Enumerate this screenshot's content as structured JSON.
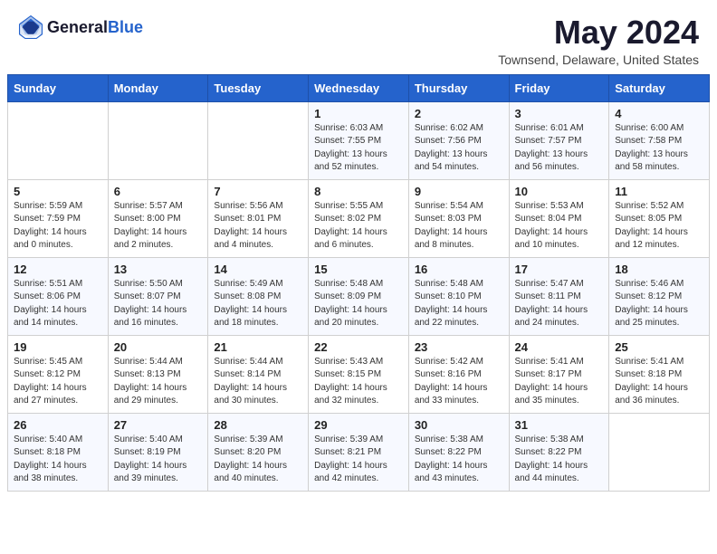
{
  "header": {
    "logo_general": "General",
    "logo_blue": "Blue",
    "month_year": "May 2024",
    "location": "Townsend, Delaware, United States"
  },
  "days_of_week": [
    "Sunday",
    "Monday",
    "Tuesday",
    "Wednesday",
    "Thursday",
    "Friday",
    "Saturday"
  ],
  "weeks": [
    [
      {
        "day": "",
        "info": ""
      },
      {
        "day": "",
        "info": ""
      },
      {
        "day": "",
        "info": ""
      },
      {
        "day": "1",
        "info": "Sunrise: 6:03 AM\nSunset: 7:55 PM\nDaylight: 13 hours\nand 52 minutes."
      },
      {
        "day": "2",
        "info": "Sunrise: 6:02 AM\nSunset: 7:56 PM\nDaylight: 13 hours\nand 54 minutes."
      },
      {
        "day": "3",
        "info": "Sunrise: 6:01 AM\nSunset: 7:57 PM\nDaylight: 13 hours\nand 56 minutes."
      },
      {
        "day": "4",
        "info": "Sunrise: 6:00 AM\nSunset: 7:58 PM\nDaylight: 13 hours\nand 58 minutes."
      }
    ],
    [
      {
        "day": "5",
        "info": "Sunrise: 5:59 AM\nSunset: 7:59 PM\nDaylight: 14 hours\nand 0 minutes."
      },
      {
        "day": "6",
        "info": "Sunrise: 5:57 AM\nSunset: 8:00 PM\nDaylight: 14 hours\nand 2 minutes."
      },
      {
        "day": "7",
        "info": "Sunrise: 5:56 AM\nSunset: 8:01 PM\nDaylight: 14 hours\nand 4 minutes."
      },
      {
        "day": "8",
        "info": "Sunrise: 5:55 AM\nSunset: 8:02 PM\nDaylight: 14 hours\nand 6 minutes."
      },
      {
        "day": "9",
        "info": "Sunrise: 5:54 AM\nSunset: 8:03 PM\nDaylight: 14 hours\nand 8 minutes."
      },
      {
        "day": "10",
        "info": "Sunrise: 5:53 AM\nSunset: 8:04 PM\nDaylight: 14 hours\nand 10 minutes."
      },
      {
        "day": "11",
        "info": "Sunrise: 5:52 AM\nSunset: 8:05 PM\nDaylight: 14 hours\nand 12 minutes."
      }
    ],
    [
      {
        "day": "12",
        "info": "Sunrise: 5:51 AM\nSunset: 8:06 PM\nDaylight: 14 hours\nand 14 minutes."
      },
      {
        "day": "13",
        "info": "Sunrise: 5:50 AM\nSunset: 8:07 PM\nDaylight: 14 hours\nand 16 minutes."
      },
      {
        "day": "14",
        "info": "Sunrise: 5:49 AM\nSunset: 8:08 PM\nDaylight: 14 hours\nand 18 minutes."
      },
      {
        "day": "15",
        "info": "Sunrise: 5:48 AM\nSunset: 8:09 PM\nDaylight: 14 hours\nand 20 minutes."
      },
      {
        "day": "16",
        "info": "Sunrise: 5:48 AM\nSunset: 8:10 PM\nDaylight: 14 hours\nand 22 minutes."
      },
      {
        "day": "17",
        "info": "Sunrise: 5:47 AM\nSunset: 8:11 PM\nDaylight: 14 hours\nand 24 minutes."
      },
      {
        "day": "18",
        "info": "Sunrise: 5:46 AM\nSunset: 8:12 PM\nDaylight: 14 hours\nand 25 minutes."
      }
    ],
    [
      {
        "day": "19",
        "info": "Sunrise: 5:45 AM\nSunset: 8:12 PM\nDaylight: 14 hours\nand 27 minutes."
      },
      {
        "day": "20",
        "info": "Sunrise: 5:44 AM\nSunset: 8:13 PM\nDaylight: 14 hours\nand 29 minutes."
      },
      {
        "day": "21",
        "info": "Sunrise: 5:44 AM\nSunset: 8:14 PM\nDaylight: 14 hours\nand 30 minutes."
      },
      {
        "day": "22",
        "info": "Sunrise: 5:43 AM\nSunset: 8:15 PM\nDaylight: 14 hours\nand 32 minutes."
      },
      {
        "day": "23",
        "info": "Sunrise: 5:42 AM\nSunset: 8:16 PM\nDaylight: 14 hours\nand 33 minutes."
      },
      {
        "day": "24",
        "info": "Sunrise: 5:41 AM\nSunset: 8:17 PM\nDaylight: 14 hours\nand 35 minutes."
      },
      {
        "day": "25",
        "info": "Sunrise: 5:41 AM\nSunset: 8:18 PM\nDaylight: 14 hours\nand 36 minutes."
      }
    ],
    [
      {
        "day": "26",
        "info": "Sunrise: 5:40 AM\nSunset: 8:18 PM\nDaylight: 14 hours\nand 38 minutes."
      },
      {
        "day": "27",
        "info": "Sunrise: 5:40 AM\nSunset: 8:19 PM\nDaylight: 14 hours\nand 39 minutes."
      },
      {
        "day": "28",
        "info": "Sunrise: 5:39 AM\nSunset: 8:20 PM\nDaylight: 14 hours\nand 40 minutes."
      },
      {
        "day": "29",
        "info": "Sunrise: 5:39 AM\nSunset: 8:21 PM\nDaylight: 14 hours\nand 42 minutes."
      },
      {
        "day": "30",
        "info": "Sunrise: 5:38 AM\nSunset: 8:22 PM\nDaylight: 14 hours\nand 43 minutes."
      },
      {
        "day": "31",
        "info": "Sunrise: 5:38 AM\nSunset: 8:22 PM\nDaylight: 14 hours\nand 44 minutes."
      },
      {
        "day": "",
        "info": ""
      }
    ]
  ]
}
